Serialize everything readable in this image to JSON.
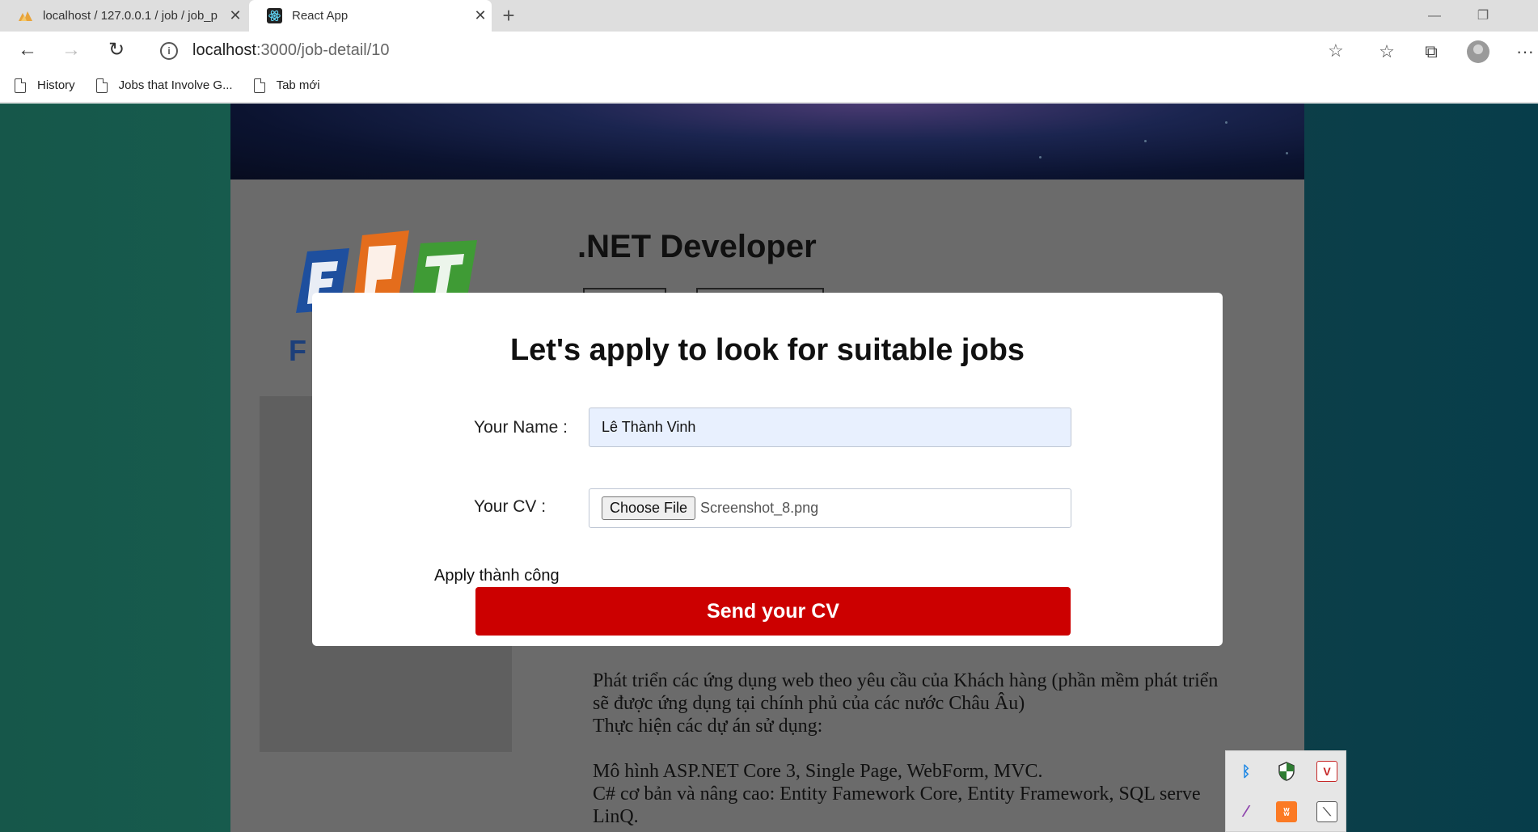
{
  "browser": {
    "tabs": [
      {
        "title": "localhost / 127.0.0.1 / job / job_p",
        "active": false,
        "icon": "phpmyadmin-icon"
      },
      {
        "title": "React App",
        "active": true,
        "icon": "react-icon"
      }
    ],
    "url_host": "localhost",
    "url_rest": ":3000/job-detail/10",
    "bookmarks": [
      {
        "label": "History"
      },
      {
        "label": "Jobs that Involve G..."
      },
      {
        "label": "Tab mới"
      }
    ]
  },
  "page": {
    "job_title": ".NET Developer",
    "company_fragment": "F",
    "logo_text": "FPT",
    "description": [
      "Phát triển các ứng dụng web theo yêu cầu của Khách hàng (phần mềm phát triển",
      "sẽ được ứng dụng tại chính phủ của các nước Châu Âu)",
      "Thực hiện các dự án sử dụng:",
      "",
      "Mô hình ASP.NET Core 3, Single Page, WebForm, MVC.",
      "C# cơ bản và nâng cao: Entity Famework Core, Entity Framework, SQL serve",
      "LinQ."
    ]
  },
  "modal": {
    "title": "Let's apply to look for suitable jobs",
    "name_label": "Your Name :",
    "name_value": "Lê Thành Vinh",
    "cv_label": "Your CV :",
    "choose_file_label": "Choose File",
    "file_name": "Screenshot_8.png",
    "status_message": "Apply thành công",
    "submit_label": "Send your CV",
    "submit_color": "#cc0000"
  },
  "tray": {
    "icons": [
      "bluetooth-icon",
      "security-shield-icon",
      "antivirus-v-icon",
      "pen-icon",
      "xampp-icon",
      "app-icon"
    ]
  }
}
